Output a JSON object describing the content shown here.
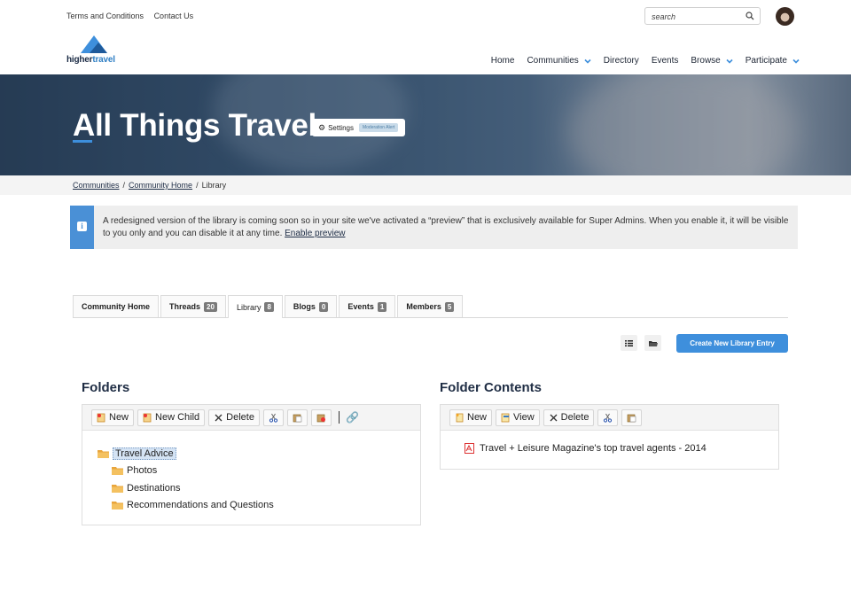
{
  "topbar": {
    "links": [
      "Terms and Conditions",
      "Contact Us"
    ],
    "search_placeholder": "search"
  },
  "logo": {
    "part1": "higher",
    "part2": "travel"
  },
  "nav": [
    {
      "label": "Home",
      "dropdown": false
    },
    {
      "label": "Communities",
      "dropdown": true
    },
    {
      "label": "Directory",
      "dropdown": false
    },
    {
      "label": "Events",
      "dropdown": false
    },
    {
      "label": "Browse",
      "dropdown": true
    },
    {
      "label": "Participate",
      "dropdown": true
    }
  ],
  "hero": {
    "title": "All Things Travel",
    "settings_label": "Settings",
    "badge": "Moderation Alert"
  },
  "breadcrumb": {
    "items": [
      "Communities",
      "Community Home"
    ],
    "current": "Library",
    "separator": "/"
  },
  "alert": {
    "text": "A redesigned version of the library is coming soon so in your site we've activated a “preview” that is exclusively available for Super Admins. When you enable it, it will be visible to you only and you can disable it at any time.",
    "link": "Enable preview"
  },
  "tabs": [
    {
      "label": "Community Home",
      "count": null,
      "active": false
    },
    {
      "label": "Threads",
      "count": "20",
      "active": false
    },
    {
      "label": "Library",
      "count": "8",
      "active": true
    },
    {
      "label": "Blogs",
      "count": "0",
      "active": false
    },
    {
      "label": "Events",
      "count": "1",
      "active": false
    },
    {
      "label": "Members",
      "count": "5",
      "active": false
    }
  ],
  "create_button": "Create New Library Entry",
  "folders": {
    "title": "Folders",
    "toolbar": {
      "new": "New",
      "new_child": "New Child",
      "delete": "Delete"
    },
    "tree": [
      {
        "label": "Travel Advice",
        "level": 0,
        "selected": true
      },
      {
        "label": "Photos",
        "level": 1,
        "selected": false
      },
      {
        "label": "Destinations",
        "level": 1,
        "selected": false
      },
      {
        "label": "Recommendations and Questions",
        "level": 1,
        "selected": false
      }
    ]
  },
  "contents": {
    "title": "Folder Contents",
    "toolbar": {
      "new": "New",
      "view": "View",
      "delete": "Delete"
    },
    "items": [
      "Travel + Leisure Magazine's top travel agents - 2014"
    ]
  },
  "colors": {
    "accent": "#3e8fdc",
    "navy": "#1f2d44",
    "alert_bar": "#4a90d6"
  }
}
